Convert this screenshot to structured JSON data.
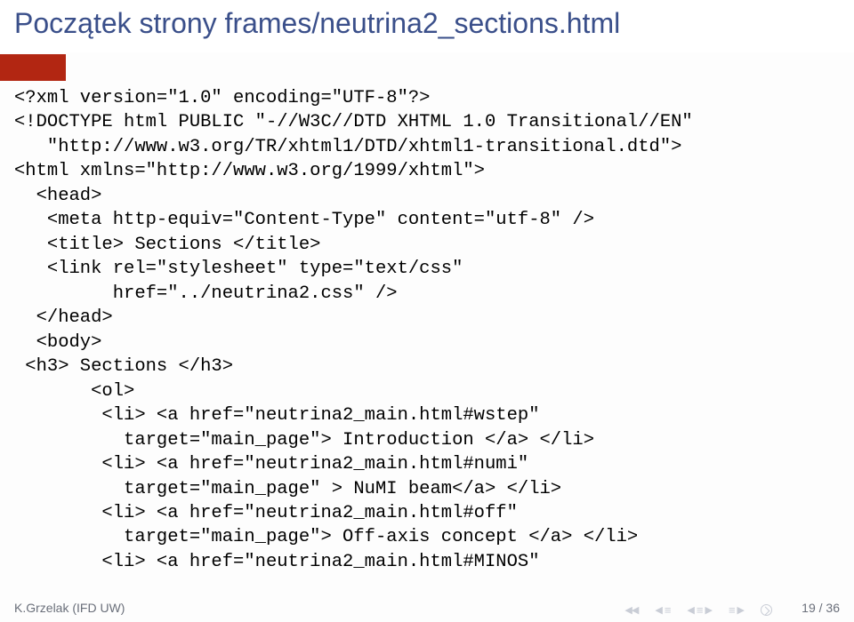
{
  "slide": {
    "title": "Początek strony frames/neutrina2_sections.html"
  },
  "code": {
    "l1": "<?xml version=\"1.0\" encoding=\"UTF-8\"?>",
    "l2": "<!DOCTYPE html PUBLIC \"-//W3C//DTD XHTML 1.0 Transitional//EN\"",
    "l3": "   \"http://www.w3.org/TR/xhtml1/DTD/xhtml1-transitional.dtd\">",
    "l4": "<html xmlns=\"http://www.w3.org/1999/xhtml\">",
    "l5": "  <head>",
    "l6": "   <meta http-equiv=\"Content-Type\" content=\"utf-8\" />",
    "l7": "   <title> Sections </title>",
    "l8": "   <link rel=\"stylesheet\" type=\"text/css\"",
    "l9": "         href=\"../neutrina2.css\" />",
    "l10": "  </head>",
    "l11": "  <body>",
    "l12": " <h3> Sections </h3>",
    "l13": "       <ol>",
    "l14": "        <li> <a href=\"neutrina2_main.html#wstep\"",
    "l15": "          target=\"main_page\"> Introduction </a> </li>",
    "l16": "        <li> <a href=\"neutrina2_main.html#numi\"",
    "l17": "          target=\"main_page\" > NuMI beam</a> </li>",
    "l18": "        <li> <a href=\"neutrina2_main.html#off\"",
    "l19": "          target=\"main_page\"> Off-axis concept </a> </li>",
    "l20": "        <li> <a href=\"neutrina2_main.html#MINOS\""
  },
  "footer": {
    "author": "K.Grzelak (IFD UW)",
    "page": "19 / 36"
  }
}
